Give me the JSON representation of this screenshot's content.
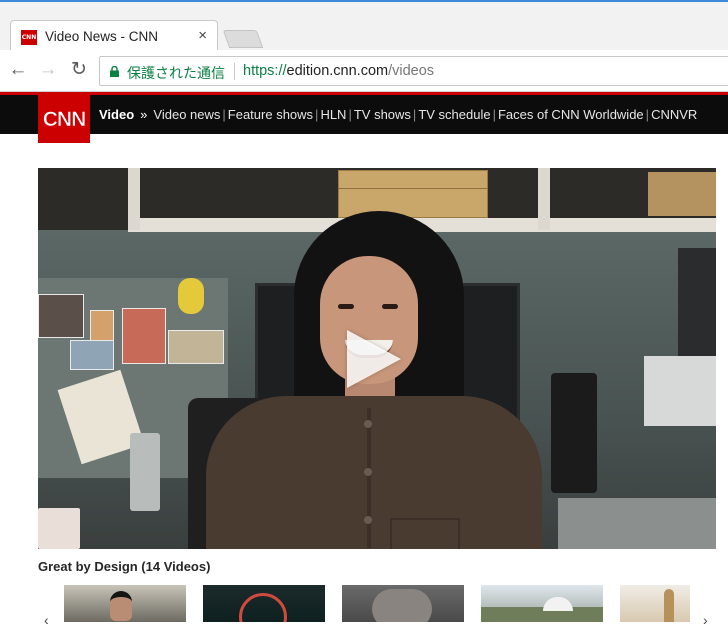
{
  "browser": {
    "tab": {
      "favicon_text": "CNN",
      "title": "Video News - CNN",
      "close": "×"
    },
    "omnibox": {
      "secure_label": "保護された通信",
      "url_scheme": "https://",
      "url_host": "edition.cnn.com",
      "url_path": "/videos"
    },
    "nav": {
      "back": "←",
      "forward": "→",
      "reload": "↻"
    }
  },
  "cnn_nav": {
    "logo_text": "CNN",
    "section": "Video",
    "separator": "»",
    "links": [
      "Video news",
      "Feature shows",
      "HLN",
      "TV shows",
      "TV schedule",
      "Faces of CNN Worldwide",
      "CNNVR"
    ]
  },
  "playlist": {
    "title": "Great by Design (14 Videos)",
    "prev": "‹",
    "next": "›"
  },
  "colors": {
    "cnn_red": "#cc0000",
    "nav_bg": "#0c0c0c",
    "secure_green": "#0b8043"
  }
}
